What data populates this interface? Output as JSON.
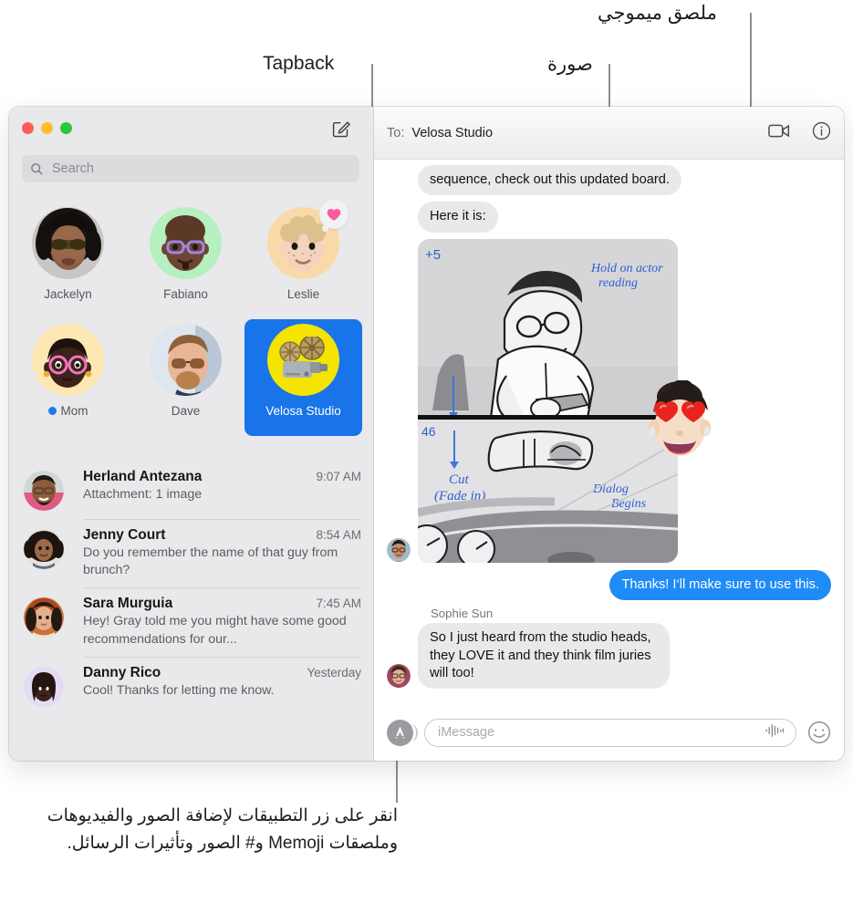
{
  "callouts": {
    "tapback": "Tapback",
    "photo": "صورة",
    "memoji_sticker": "ملصق ميموجي",
    "bottom_caption": "انقر على زر التطبيقات لإضافة الصور والفيديوهات وملصقات Memoji و# الصور وتأثيرات الرسائل."
  },
  "sidebar": {
    "search": {
      "placeholder": "Search",
      "value": "",
      "icon": "search-icon"
    },
    "compose_icon": "compose-icon",
    "traffic_lights": [
      "close",
      "minimize",
      "zoom"
    ],
    "pinned": [
      {
        "name": "Jackelyn",
        "selected": false,
        "unread": false,
        "tapback": null
      },
      {
        "name": "Fabiano",
        "selected": false,
        "unread": false,
        "tapback": null
      },
      {
        "name": "Leslie",
        "selected": false,
        "unread": false,
        "tapback": "heart"
      },
      {
        "name": "Mom",
        "selected": false,
        "unread": true,
        "tapback": null
      },
      {
        "name": "Dave",
        "selected": false,
        "unread": false,
        "tapback": null
      },
      {
        "name": "Velosa Studio",
        "selected": true,
        "unread": false,
        "tapback": null
      }
    ],
    "conversations": [
      {
        "name": "Herland Antezana",
        "time": "9:07 AM",
        "snippet": "Attachment: 1 image"
      },
      {
        "name": "Jenny Court",
        "time": "8:54 AM",
        "snippet": "Do you remember the name of that guy from brunch?"
      },
      {
        "name": "Sara Murguia",
        "time": "7:45 AM",
        "snippet": "Hey! Gray told me you might have some good recommendations for our..."
      },
      {
        "name": "Danny Rico",
        "time": "Yesterday",
        "snippet": "Cool! Thanks for letting me know."
      }
    ]
  },
  "pane": {
    "to_label": "To:",
    "to_value": "Velosa Studio",
    "facetime_icon": "video-camera-icon",
    "details_icon": "info-icon",
    "messages": [
      {
        "type": "text",
        "dir": "in",
        "text": "sequence, check out this updated board."
      },
      {
        "type": "text",
        "dir": "in",
        "text": "Here it is:"
      },
      {
        "type": "image",
        "dir": "in",
        "alt": "storyboard",
        "annotations": [
          "+5",
          "Hold on actor reading",
          "46",
          "Cut (Fade in)",
          "Dialog Begins Here"
        ]
      },
      {
        "type": "text",
        "dir": "out",
        "text": "Thanks! I‘ll make sure to use this."
      },
      {
        "type": "text",
        "dir": "in",
        "sender": "Sophie Sun",
        "text": "So I just heard from the studio heads, they LOVE it and they think film juries will too!"
      }
    ],
    "input": {
      "apps_icon": "apps-store-icon",
      "placeholder": "iMessage",
      "value": "",
      "audio_icon": "audio-waveform-icon",
      "emoji_icon": "smiley-face-icon"
    }
  },
  "colors": {
    "accent_blue": "#1f8bf7",
    "selected_blue": "#1874e8",
    "sidebar_bg": "#e9e8ea",
    "bubble_in": "#e9e9eb",
    "tapback_pink": "#ff5c9d",
    "unread_dot": "#1a7cf0"
  }
}
